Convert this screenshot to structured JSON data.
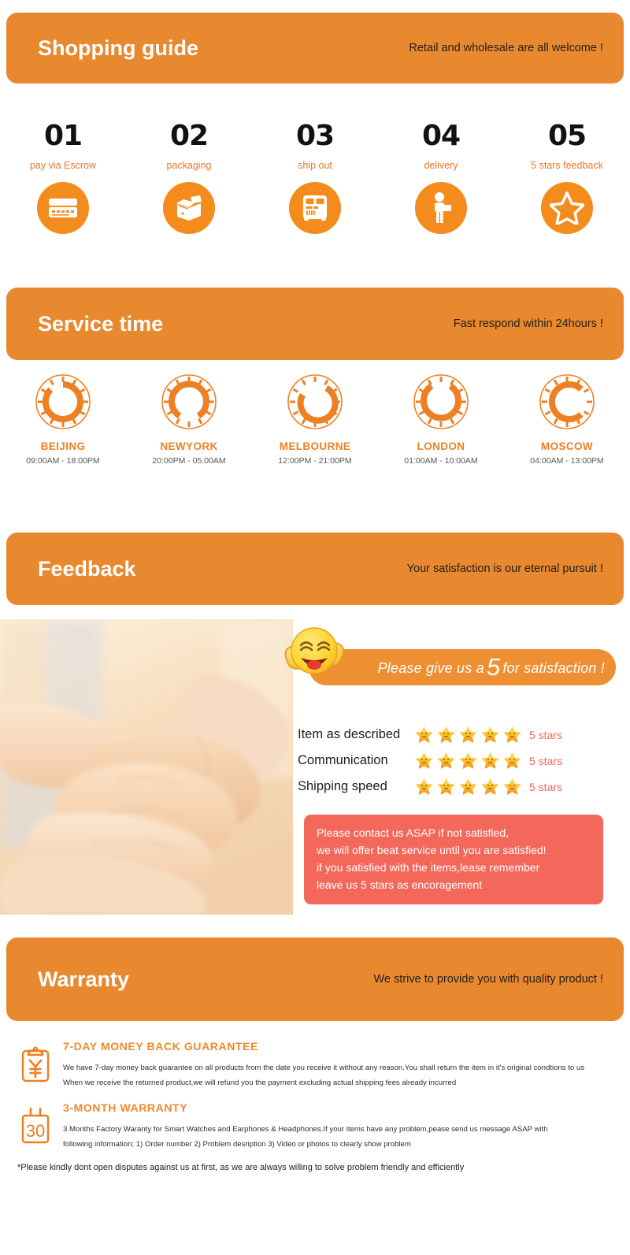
{
  "sections": {
    "shopping_guide": {
      "title": "Shopping guide",
      "subtitle": "Retail and wholesale are all welcome !"
    },
    "service_time": {
      "title": "Service time",
      "subtitle": "Fast respond within 24hours !"
    },
    "feedback": {
      "title": "Feedback",
      "subtitle": "Your satisfaction is our eternal pursuit !"
    },
    "warranty": {
      "title": "Warranty",
      "subtitle": "We strive to provide you with quality product !"
    }
  },
  "steps": [
    {
      "number": "01",
      "label": "pay via Escrow",
      "icon": "credit-card-icon"
    },
    {
      "number": "02",
      "label": "packaging",
      "icon": "open-box-icon"
    },
    {
      "number": "03",
      "label": "ship out",
      "icon": "bus-icon"
    },
    {
      "number": "04",
      "label": "delivery",
      "icon": "courier-person-icon"
    },
    {
      "number": "05",
      "label": "5 stars feedback",
      "icon": "star-outline-icon"
    }
  ],
  "clocks": [
    {
      "city": "BEIJING",
      "hours": "09:00AM - 18:00PM",
      "icon": "clock-icon"
    },
    {
      "city": "NEWYORK",
      "hours": "20:00PM - 05:00AM",
      "icon": "clock-icon"
    },
    {
      "city": "MELBOURNE",
      "hours": "12:00PM - 21:00PM",
      "icon": "clock-icon"
    },
    {
      "city": "LONDON",
      "hours": "01:00AM - 10:00AM",
      "icon": "clock-icon"
    },
    {
      "city": "MOSCOW",
      "hours": "04:00AM - 13:00PM",
      "icon": "clock-icon"
    }
  ],
  "feedback_body": {
    "photo_alt": "hands-stacked-teamwork-photo",
    "smiley_icon": "laughing-thumbs-up-smiley-icon",
    "pill": {
      "prefix": "Please give us a",
      "rating": "5",
      "suffix": "for satisfaction",
      "exclaim": "!"
    },
    "ratings": [
      {
        "label": "Item as described",
        "stars": 5,
        "value": "5 stars"
      },
      {
        "label": "Communication",
        "stars": 5,
        "value": "5 stars"
      },
      {
        "label": "Shipping speed",
        "stars": 5,
        "value": "5 stars"
      }
    ],
    "note_lines": [
      "Please contact us ASAP if not satisfied,",
      "we will offer beat service until you are satisfied!",
      "if you satisfied with the items,lease remember",
      "leave us 5 stars as encoragement"
    ]
  },
  "warranty_body": {
    "items": [
      {
        "icon": "clipboard-yen-icon",
        "heading": "7-DAY MONEY BACK GUARANTEE",
        "lines": [
          "We have 7-day money back guarantee on all products from the date you receive it without any reason.You shall return the item in it's original condtions to us",
          "When we receive  the returned product,we will refund you the payment excluding actual shipping fees already incurred"
        ]
      },
      {
        "icon": "calendar-30-icon",
        "heading": "3-MONTH WARRANTY",
        "lines": [
          "3 Months Factory Waranty for Smart Watches and Earphones & Headphones.If your items have any problem,pease send us message ASAP with",
          "following information; 1) Order number 2) Problem desription 3) Video or photos to clearly show problem"
        ]
      }
    ],
    "disclaimer": "*Please kindly dont open disputes against us at first, as we are always willing to solve problem friendly and efficiently"
  },
  "colors": {
    "banner_orange": "#e8882f",
    "icon_orange": "#f38c1c",
    "label_orange": "#e8782a",
    "clock_orange": "#ee8024",
    "note_red": "#f4685c",
    "star_yellow": "#f9b81d",
    "rating_value_red": "#f2695f",
    "heading_orange": "#f18a2c"
  }
}
